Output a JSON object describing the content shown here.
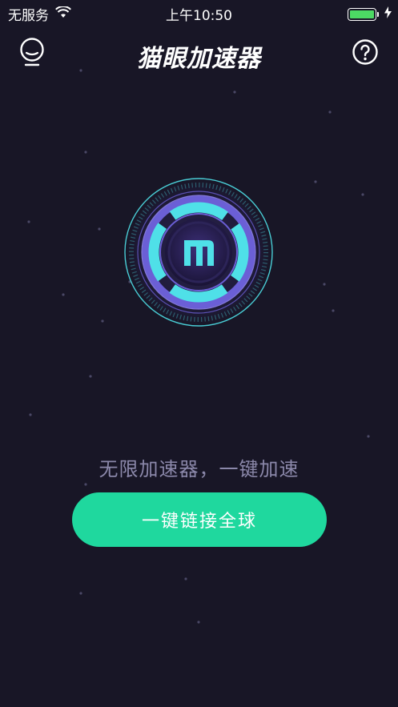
{
  "status_bar": {
    "carrier": "无服务",
    "time": "上午10:50",
    "wifi_icon": "wifi-icon",
    "battery_icon": "battery-icon",
    "charging_icon": "charging-icon",
    "battery_color": "#4cd964"
  },
  "nav": {
    "title": "猫眼加速器",
    "left_icon": "lightbulb-icon",
    "right_icon": "help-icon"
  },
  "main": {
    "logo_icon": "app-logo-m-icon",
    "slogan": "无限加速器，一键加速",
    "connect_button_label": "一键链接全球"
  },
  "colors": {
    "background": "#181626",
    "accent": "#1fd89e",
    "logo_cyan": "#4fe0e8",
    "logo_purple": "#6b5fd6",
    "slogan_text": "#8b88aa"
  }
}
